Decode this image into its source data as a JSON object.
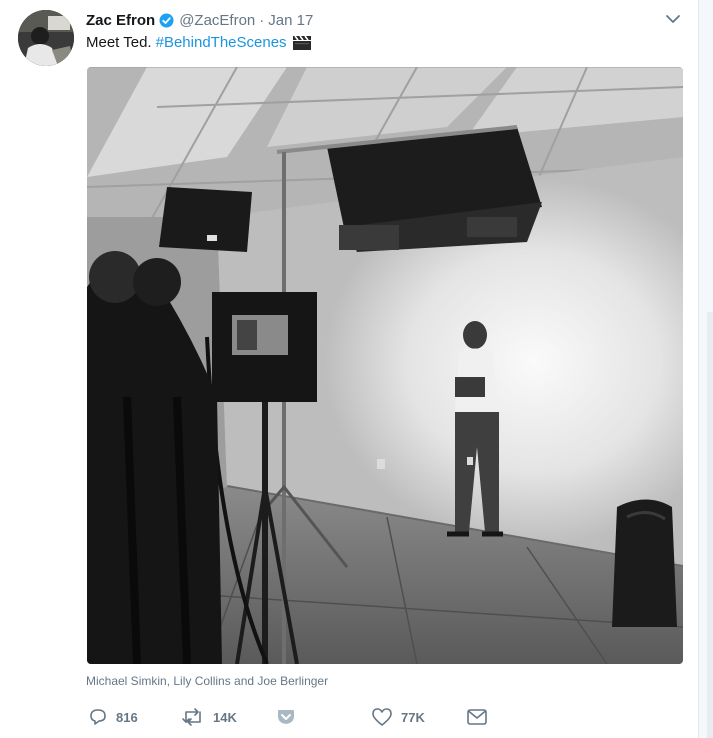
{
  "tweet": {
    "author_name": "Zac Efron",
    "handle": "@ZacEfron",
    "separator": "·",
    "date": "Jan 17",
    "text": "Meet Ted.",
    "hashtag": "#BehindTheScenes",
    "tagged_people": "Michael Simkin, Lily Collins and Joe Berlinger"
  },
  "actions": {
    "replies": "816",
    "retweets": "14K",
    "likes": "77K"
  },
  "colors": {
    "link": "#1b95e0",
    "secondary_text": "#657786",
    "primary_text": "#14171a",
    "verified": "#1da1f2"
  },
  "icons": [
    "verified-badge-icon",
    "chevron-down-icon",
    "clapper-board-icon",
    "reply-icon",
    "retweet-icon",
    "save-icon",
    "like-icon",
    "direct-message-icon"
  ]
}
